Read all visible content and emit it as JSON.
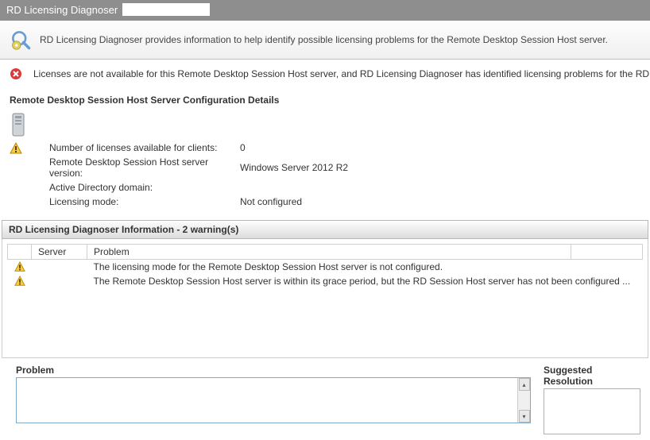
{
  "window": {
    "title": "RD Licensing Diagnoser"
  },
  "banner": {
    "text": "RD Licensing Diagnoser provides information to help identify possible licensing problems for the Remote Desktop Session Host server."
  },
  "error": {
    "text": "Licenses are not available for this Remote Desktop Session Host server, and RD Licensing Diagnoser has identified licensing problems for the RD Session Host se"
  },
  "config": {
    "heading": "Remote Desktop Session Host Server Configuration Details",
    "rows": {
      "licenses_label": "Number of licenses available for clients:",
      "licenses_value": "0",
      "version_label": "Remote Desktop Session Host server version:",
      "version_value": "Windows Server 2012 R2",
      "domain_label": "Active Directory domain:",
      "domain_value": "",
      "mode_label": "Licensing mode:",
      "mode_value": "Not configured"
    }
  },
  "warnings": {
    "header": "RD Licensing Diagnoser Information - 2 warning(s)",
    "columns": {
      "icon": "",
      "server": "Server",
      "problem": "Problem"
    },
    "items": [
      {
        "server": "",
        "problem": "The licensing mode for the Remote Desktop Session Host server is not configured."
      },
      {
        "server": "",
        "problem": "The Remote Desktop Session Host server is within its grace period, but the RD Session Host server has not been configured ..."
      }
    ]
  },
  "panels": {
    "problem_label": "Problem",
    "suggest_label": "Suggested Resolution",
    "problem_text": "",
    "suggest_text": ""
  }
}
